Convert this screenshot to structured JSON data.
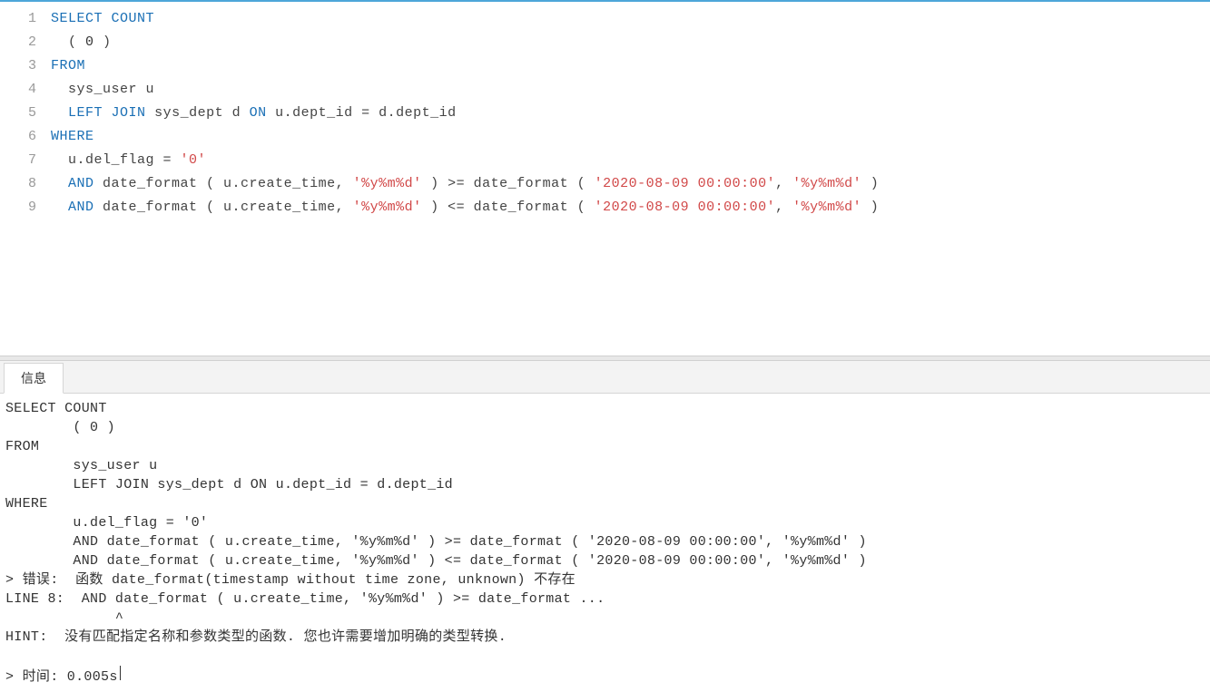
{
  "editor": {
    "lines": [
      {
        "num": "1",
        "tokens": [
          {
            "t": "kw",
            "v": "SELECT"
          },
          {
            "t": "ident",
            "v": " "
          },
          {
            "t": "kw",
            "v": "COUNT"
          }
        ]
      },
      {
        "num": "2",
        "tokens": [
          {
            "t": "ident",
            "v": "  ( "
          },
          {
            "t": "num",
            "v": "0"
          },
          {
            "t": "ident",
            "v": " ) "
          }
        ]
      },
      {
        "num": "3",
        "tokens": [
          {
            "t": "kw",
            "v": "FROM"
          }
        ]
      },
      {
        "num": "4",
        "tokens": [
          {
            "t": "ident",
            "v": "  sys_user u"
          }
        ]
      },
      {
        "num": "5",
        "tokens": [
          {
            "t": "ident",
            "v": "  "
          },
          {
            "t": "kw",
            "v": "LEFT"
          },
          {
            "t": "ident",
            "v": " "
          },
          {
            "t": "kw",
            "v": "JOIN"
          },
          {
            "t": "ident",
            "v": " sys_dept d "
          },
          {
            "t": "kw",
            "v": "ON"
          },
          {
            "t": "ident",
            "v": " u.dept_id = d.dept_id"
          }
        ]
      },
      {
        "num": "6",
        "tokens": [
          {
            "t": "kw",
            "v": "WHERE"
          }
        ]
      },
      {
        "num": "7",
        "tokens": [
          {
            "t": "ident",
            "v": "  u.del_flag = "
          },
          {
            "t": "str",
            "v": "'0'"
          }
        ]
      },
      {
        "num": "8",
        "tokens": [
          {
            "t": "ident",
            "v": "  "
          },
          {
            "t": "kw",
            "v": "AND"
          },
          {
            "t": "ident",
            "v": " date_format ( u.create_time, "
          },
          {
            "t": "str",
            "v": "'%y%m%d'"
          },
          {
            "t": "ident",
            "v": " ) >= date_format ( "
          },
          {
            "t": "str",
            "v": "'2020-08-09 00:00:00'"
          },
          {
            "t": "ident",
            "v": ", "
          },
          {
            "t": "str",
            "v": "'%y%m%d'"
          },
          {
            "t": "ident",
            "v": " )"
          }
        ]
      },
      {
        "num": "9",
        "tokens": [
          {
            "t": "ident",
            "v": "  "
          },
          {
            "t": "kw",
            "v": "AND"
          },
          {
            "t": "ident",
            "v": " date_format ( u.create_time, "
          },
          {
            "t": "str",
            "v": "'%y%m%d'"
          },
          {
            "t": "ident",
            "v": " ) <= date_format ( "
          },
          {
            "t": "str",
            "v": "'2020-08-09 00:00:00'"
          },
          {
            "t": "ident",
            "v": ", "
          },
          {
            "t": "str",
            "v": "'%y%m%d'"
          },
          {
            "t": "ident",
            "v": " )"
          }
        ]
      }
    ]
  },
  "output": {
    "tab_label": "信息",
    "text": "SELECT COUNT\n        ( 0 ) \nFROM\n        sys_user u\n        LEFT JOIN sys_dept d ON u.dept_id = d.dept_id \nWHERE\n        u.del_flag = '0' \n        AND date_format ( u.create_time, '%y%m%d' ) >= date_format ( '2020-08-09 00:00:00', '%y%m%d' ) \n        AND date_format ( u.create_time, '%y%m%d' ) <= date_format ( '2020-08-09 00:00:00', '%y%m%d' )\n> 错误:  函数 date_format(timestamp without time zone, unknown) 不存在\nLINE 8:  AND date_format ( u.create_time, '%y%m%d' ) >= date_format ...\n             ^\nHINT:  没有匹配指定名称和参数类型的函数. 您也许需要增加明确的类型转换.\n\n> 时间: 0.005s"
  }
}
